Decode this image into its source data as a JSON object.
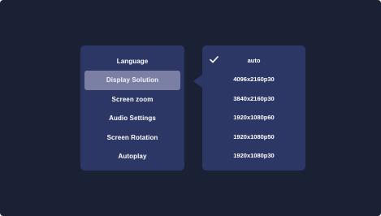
{
  "left_menu": {
    "items": [
      {
        "label": "Language"
      },
      {
        "label": "Display Solution"
      },
      {
        "label": "Screen zoom"
      },
      {
        "label": "Audio Settings"
      },
      {
        "label": "Screen Rotation"
      },
      {
        "label": "Autoplay"
      }
    ],
    "selected_index": 1
  },
  "right_menu": {
    "options": [
      {
        "label": "auto",
        "checked": true
      },
      {
        "label": "4096x2160p30",
        "checked": false
      },
      {
        "label": "3840x2160p30",
        "checked": false
      },
      {
        "label": "1920x1080p60",
        "checked": false
      },
      {
        "label": "1920x1080p50",
        "checked": false
      },
      {
        "label": "1920x1080p30",
        "checked": false
      }
    ],
    "check_icon": "checkmark-icon"
  },
  "colors": {
    "background": "#1b2134",
    "panel": "#2d3766",
    "selected_item": "#7a7fa3",
    "text": "#ffffff"
  }
}
